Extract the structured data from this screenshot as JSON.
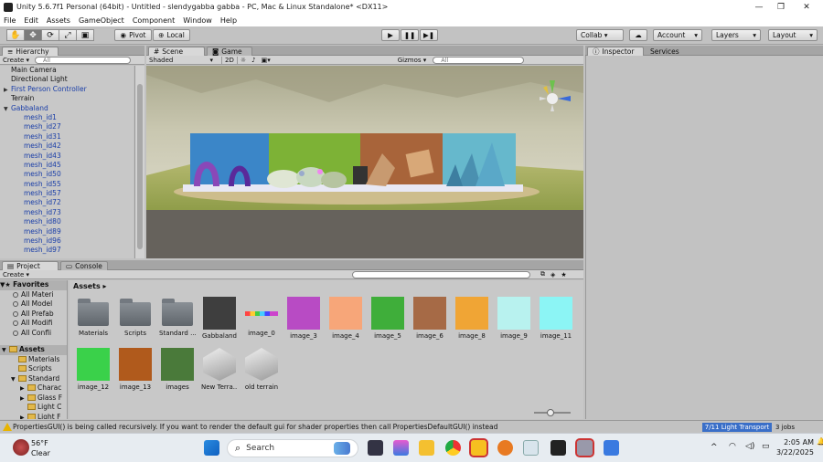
{
  "window": {
    "title": "Unity 5.6.7f1 Personal (64bit) - Untitled - slendygabba gabba - PC, Mac & Linux Standalone* <DX11>"
  },
  "menu": [
    "File",
    "Edit",
    "Assets",
    "GameObject",
    "Component",
    "Window",
    "Help"
  ],
  "toolbar": {
    "pivot": "Pivot",
    "local": "Local",
    "collab": "Collab ▾",
    "account": "Account",
    "layers": "Layers",
    "layout": "Layout"
  },
  "hierarchy": {
    "tab": "Hierarchy",
    "create": "Create",
    "search_placeholder": "All",
    "items": [
      {
        "label": "Main Camera",
        "indent": 1,
        "prefab": false,
        "arrow": ""
      },
      {
        "label": "Directional Light",
        "indent": 1,
        "prefab": false,
        "arrow": ""
      },
      {
        "label": "First Person Controller",
        "indent": 1,
        "prefab": true,
        "arrow": "▶"
      },
      {
        "label": "Terrain",
        "indent": 1,
        "prefab": false,
        "arrow": ""
      },
      {
        "label": "Gabbaland",
        "indent": 1,
        "prefab": true,
        "arrow": "▼"
      },
      {
        "label": "mesh_id1",
        "indent": 2,
        "prefab": true,
        "arrow": ""
      },
      {
        "label": "mesh_id27",
        "indent": 2,
        "prefab": true,
        "arrow": ""
      },
      {
        "label": "mesh_id31",
        "indent": 2,
        "prefab": true,
        "arrow": ""
      },
      {
        "label": "mesh_id42",
        "indent": 2,
        "prefab": true,
        "arrow": ""
      },
      {
        "label": "mesh_id43",
        "indent": 2,
        "prefab": true,
        "arrow": ""
      },
      {
        "label": "mesh_id45",
        "indent": 2,
        "prefab": true,
        "arrow": ""
      },
      {
        "label": "mesh_id50",
        "indent": 2,
        "prefab": true,
        "arrow": ""
      },
      {
        "label": "mesh_id55",
        "indent": 2,
        "prefab": true,
        "arrow": ""
      },
      {
        "label": "mesh_id57",
        "indent": 2,
        "prefab": true,
        "arrow": ""
      },
      {
        "label": "mesh_id72",
        "indent": 2,
        "prefab": true,
        "arrow": ""
      },
      {
        "label": "mesh_id73",
        "indent": 2,
        "prefab": true,
        "arrow": ""
      },
      {
        "label": "mesh_id80",
        "indent": 2,
        "prefab": true,
        "arrow": ""
      },
      {
        "label": "mesh_id89",
        "indent": 2,
        "prefab": true,
        "arrow": ""
      },
      {
        "label": "mesh_id96",
        "indent": 2,
        "prefab": true,
        "arrow": ""
      },
      {
        "label": "mesh_id97",
        "indent": 2,
        "prefab": true,
        "arrow": ""
      }
    ]
  },
  "scene": {
    "tab_scene": "Scene",
    "tab_game": "Game",
    "shaded": "Shaded",
    "mode_2d": "2D",
    "gizmos": "Gizmos",
    "search_placeholder": "All"
  },
  "inspector": {
    "tab": "Inspector",
    "services": "Services"
  },
  "project": {
    "tab": "Project",
    "console": "Console",
    "create": "Create",
    "breadcrumb": "Assets",
    "favorites": [
      {
        "label": "Favorites",
        "section": true
      },
      {
        "label": "All Materi",
        "section": false
      },
      {
        "label": "All Model",
        "section": false
      },
      {
        "label": "All Prefab",
        "section": false
      },
      {
        "label": "All Modifi",
        "section": false
      },
      {
        "label": "All Confli",
        "section": false
      }
    ],
    "tree": [
      {
        "label": "Assets",
        "section": true,
        "arrow": "▼"
      },
      {
        "label": "Materials",
        "section": false,
        "arrow": ""
      },
      {
        "label": "Scripts",
        "section": false,
        "arrow": ""
      },
      {
        "label": "Standard",
        "section": false,
        "arrow": "▼"
      },
      {
        "label": "Charac",
        "section": false,
        "arrow": "▶"
      },
      {
        "label": "Glass F",
        "section": false,
        "arrow": "▶"
      },
      {
        "label": "Light C",
        "section": false,
        "arrow": ""
      },
      {
        "label": "Light F",
        "section": false,
        "arrow": "▶"
      }
    ],
    "assets": [
      {
        "label": "Materials",
        "kind": "folder",
        "color": ""
      },
      {
        "label": "Scripts",
        "kind": "folder",
        "color": ""
      },
      {
        "label": "Standard ...",
        "kind": "folder",
        "color": ""
      },
      {
        "label": "Gabbaland",
        "kind": "model",
        "color": "#3e3e3e"
      },
      {
        "label": "image_0",
        "kind": "strip",
        "color": ""
      },
      {
        "label": "image_3",
        "kind": "image",
        "color": "#b84bc4"
      },
      {
        "label": "image_4",
        "kind": "image",
        "color": "#f7a679"
      },
      {
        "label": "image_5",
        "kind": "image",
        "color": "#3fae3a"
      },
      {
        "label": "image_6",
        "kind": "image",
        "color": "#a66a46"
      },
      {
        "label": "image_8",
        "kind": "image",
        "color": "#f0a535"
      },
      {
        "label": "image_9",
        "kind": "image",
        "color": "#b8f2ef"
      },
      {
        "label": "image_11",
        "kind": "image",
        "color": "#8cf5f5"
      },
      {
        "label": "image_12",
        "kind": "image",
        "color": "#3ad14a"
      },
      {
        "label": "image_13",
        "kind": "image",
        "color": "#b05a1c"
      },
      {
        "label": "images",
        "kind": "image",
        "color": "#4a7a3a"
      },
      {
        "label": "New Terra...",
        "kind": "terrain",
        "color": ""
      },
      {
        "label": "old terrain",
        "kind": "terrain",
        "color": ""
      }
    ]
  },
  "status": {
    "message": "PropertiesGUI() is being called recursively. If you want to render the default gui for shader properties then call PropertiesDefaultGUI() instead",
    "light": "7/11 Light Transport",
    "jobs": "3 jobs"
  },
  "taskbar": {
    "weather_temp": "56°F",
    "weather_desc": "Clear",
    "search": "Search",
    "time": "2:05 AM",
    "date": "3/22/2025"
  }
}
